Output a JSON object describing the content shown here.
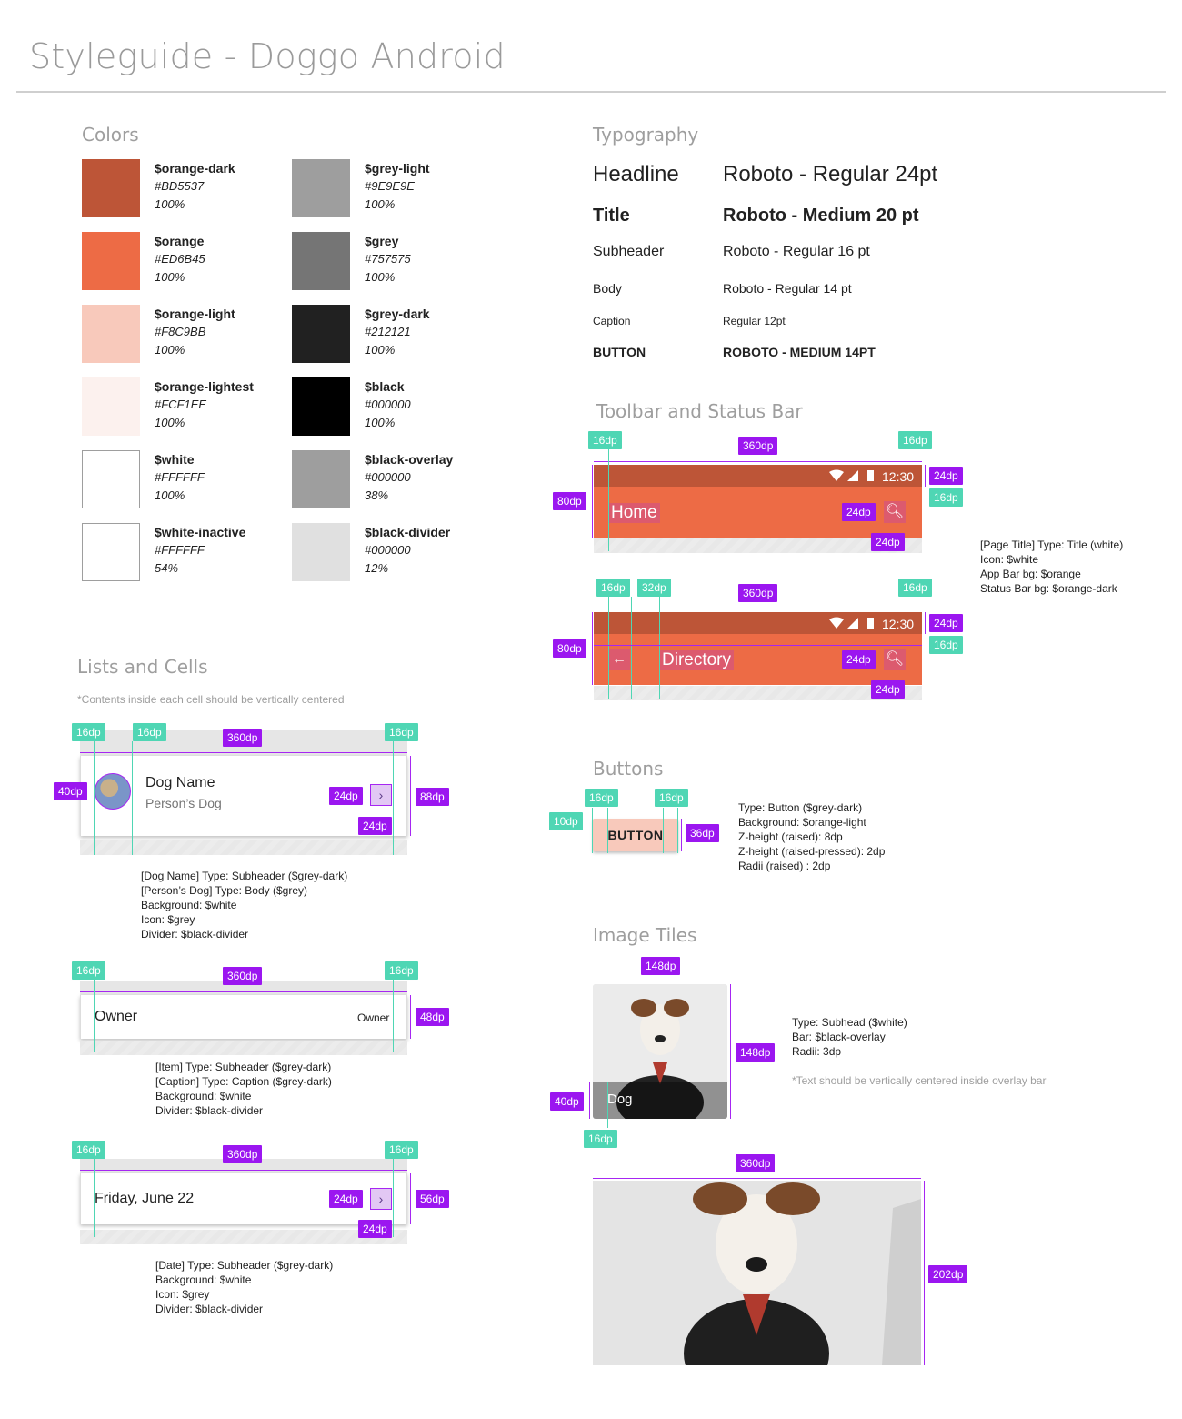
{
  "page": {
    "title": "Styleguide - Doggo Android"
  },
  "colors": {
    "title": "Colors",
    "items": [
      {
        "name": "$orange-dark",
        "hex": "#BD5537",
        "opacity": "100%",
        "swatch": "#BD5537"
      },
      {
        "name": "$orange",
        "hex": "#ED6B45",
        "opacity": "100%",
        "swatch": "#ED6B45"
      },
      {
        "name": "$orange-light",
        "hex": "#F8C9BB",
        "opacity": "100%",
        "swatch": "#F8C9BB"
      },
      {
        "name": "$orange-lightest",
        "hex": "#FCF1EE",
        "opacity": "100%",
        "swatch": "#FCF1EE"
      },
      {
        "name": "$white",
        "hex": "#FFFFFF",
        "opacity": "100%",
        "swatch": "#FFFFFF"
      },
      {
        "name": "$white-inactive",
        "hex": "#FFFFFF",
        "opacity": "54%",
        "swatch": "#FFFFFF"
      },
      {
        "name": "$grey-light",
        "hex": "#9E9E9E",
        "opacity": "100%",
        "swatch": "#9E9E9E"
      },
      {
        "name": "$grey",
        "hex": "#757575",
        "opacity": "100%",
        "swatch": "#757575"
      },
      {
        "name": "$grey-dark",
        "hex": "#212121",
        "opacity": "100%",
        "swatch": "#212121"
      },
      {
        "name": "$black",
        "hex": "#000000",
        "opacity": "100%",
        "swatch": "#000000"
      },
      {
        "name": "$black-overlay",
        "hex": "#000000",
        "opacity": "38%",
        "swatch": "#9E9E9E"
      },
      {
        "name": "$black-divider",
        "hex": "#000000",
        "opacity": "12%",
        "swatch": "#E0E0E0"
      }
    ]
  },
  "typography": {
    "title": "Typography",
    "rows": [
      {
        "label": "Headline",
        "value": "Roboto - Regular 24pt"
      },
      {
        "label": "Title",
        "value": "Roboto - Medium 20 pt"
      },
      {
        "label": "Subheader",
        "value": "Roboto - Regular 16 pt"
      },
      {
        "label": "Body",
        "value": "Roboto - Regular 14 pt"
      },
      {
        "label": "Caption",
        "value": "Regular 12pt"
      },
      {
        "label": "BUTTON",
        "value": "ROBOTO - MEDIUM 14PT"
      }
    ]
  },
  "toolbar": {
    "title": "Toolbar and Status Bar",
    "time": "12:30",
    "home_title": "Home",
    "directory_title": "Directory",
    "note": "[Page Title] Type: Title (white)\nIcon: $white\nApp Bar bg: $orange\nStatus Bar bg: $orange-dark"
  },
  "lists": {
    "title": "Lists and Cells",
    "subtitle": "*Contents inside each cell should be vertically centered",
    "dog_name": "Dog Name",
    "person_dog": "Person’s Dog",
    "note1": "[Dog Name] Type: Subheader ($grey-dark)\n[Person’s Dog] Type: Body ($grey)\nBackground: $white\nIcon: $grey\nDivider: $black-divider",
    "owner_item": "Owner",
    "owner_caption": "Owner",
    "note2": "[Item] Type: Subheader ($grey-dark)\n[Caption] Type: Caption ($grey-dark)\nBackground: $white\nDivider: $black-divider",
    "date": "Friday, June 22",
    "note3": "[Date] Type: Subheader ($grey-dark)\nBackground: $white\nIcon: $grey\nDivider: $black-divider"
  },
  "buttons": {
    "title": "Buttons",
    "label": "BUTTON",
    "note": "Type: Button ($grey-dark)\nBackground: $orange-light\nZ-height (raised): 8dp\nZ-height (raised-pressed): 2dp\nRadii (raised) : 2dp"
  },
  "tiles": {
    "title": "Image Tiles",
    "tile_label": "Dog",
    "note": "Type: Subhead ($white)\nBar: $black-overlay\nRadii: 3dp",
    "note2": "*Text should be vertically centered inside overlay bar"
  },
  "dims": {
    "d10": "10dp",
    "d16": "16dp",
    "d24": "24dp",
    "d32": "32dp",
    "d36": "36dp",
    "d40": "40dp",
    "d48": "48dp",
    "d56": "56dp",
    "d80": "80dp",
    "d88": "88dp",
    "d148": "148dp",
    "d202": "202dp",
    "d360": "360dp"
  }
}
